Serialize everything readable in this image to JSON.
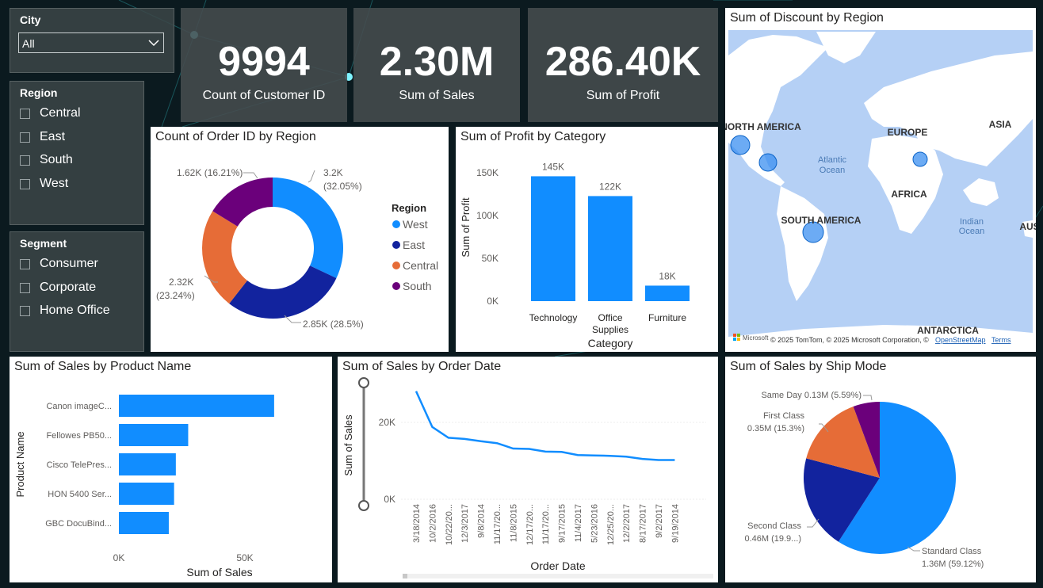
{
  "colors": {
    "blue": "#118DFF",
    "dark_blue": "#12239E",
    "orange": "#E66C37",
    "purple": "#6B007B",
    "map_land": "#ffffff",
    "map_water": "#b5d0f5"
  },
  "city_slicer": {
    "title": "City",
    "selected": "All"
  },
  "region_slicer": {
    "title": "Region",
    "items": [
      "Central",
      "East",
      "South",
      "West"
    ]
  },
  "segment_slicer": {
    "title": "Segment",
    "items": [
      "Consumer",
      "Corporate",
      "Home Office"
    ]
  },
  "kpis": [
    {
      "value": "9994",
      "label": "Count of Customer ID"
    },
    {
      "value": "2.30M",
      "label": "Sum of Sales"
    },
    {
      "value": "286.40K",
      "label": "Sum of Profit"
    }
  ],
  "donut": {
    "title": "Count of Order ID by Region",
    "legend_title": "Region",
    "legend": [
      "West",
      "East",
      "Central",
      "South"
    ],
    "labels": [
      "3.2K",
      "(32.05%)",
      "2.85K (28.5%)",
      "2.32K",
      "(23.24%)",
      "1.62K (16.21%)"
    ]
  },
  "profit_chart": {
    "title": "Sum of Profit by Category",
    "xlabel": "Category",
    "ylabel": "Sum of Profit",
    "ticks": [
      "0K",
      "50K",
      "100K",
      "150K"
    ],
    "category_lines": [
      [
        "Technology"
      ],
      [
        "Office",
        "Supplies"
      ],
      [
        "Furniture"
      ]
    ],
    "data_labels": [
      "145K",
      "122K",
      "18K"
    ]
  },
  "map": {
    "title": "Sum of Discount by Region",
    "continents": [
      "NORTH AMERICA",
      "EUROPE",
      "ASIA",
      "AFRICA",
      "SOUTH AMERICA",
      "ANTARCTICA",
      "AUS"
    ],
    "oceans": [
      "Atlantic",
      "Ocean",
      "Indian",
      "Ocean"
    ],
    "attribution": "© 2025 TomTom, © 2025 Microsoft Corporation, ©",
    "osm_link": "OpenStreetMap",
    "terms_link": "Terms",
    "brand": "Microsoft"
  },
  "product_chart": {
    "title": "Sum of Sales by Product Name",
    "xlabel": "Sum of Sales",
    "ylabel": "Product Name",
    "ticks": [
      "0K",
      "50K"
    ]
  },
  "date_chart": {
    "title": "Sum of Sales by Order Date",
    "xlabel": "Order Date",
    "ylabel": "Sum of Sales",
    "ticks": [
      "0K",
      "20K"
    ]
  },
  "pie": {
    "title": "Sum of Sales by Ship Mode",
    "labels": [
      "Same Day 0.13M (5.59%)",
      "First Class",
      "0.35M (15.3%)",
      "Second Class",
      "0.46M (19.9...)",
      "Standard Class",
      "1.36M (59.12%)"
    ]
  },
  "chart_data": [
    {
      "type": "pie",
      "title": "Count of Order ID by Region",
      "categories": [
        "West",
        "East",
        "Central",
        "South"
      ],
      "values": [
        3200,
        2850,
        2320,
        1620
      ],
      "percents": [
        32.05,
        28.5,
        23.24,
        16.21
      ]
    },
    {
      "type": "bar",
      "title": "Sum of Profit by Category",
      "categories": [
        "Technology",
        "Office Supplies",
        "Furniture"
      ],
      "values": [
        145,
        122,
        18
      ],
      "ylim": [
        0,
        150
      ]
    },
    {
      "type": "bar",
      "title": "Sum of Sales by Product Name",
      "categories": [
        "Canon imageC...",
        "Fellowes PB50...",
        "Cisco TelePres...",
        "HON 5400 Ser...",
        "GBC DocuBind..."
      ],
      "values": [
        61.6,
        27.5,
        22.6,
        21.9,
        19.8
      ],
      "xlim": [
        0,
        50
      ]
    },
    {
      "type": "line",
      "title": "Sum of Sales by Order Date",
      "x": [
        "3/18/2014",
        "10/2/2016",
        "10/22/20...",
        "12/3/2017",
        "9/8/2014",
        "11/17/20...",
        "11/8/2015",
        "12/17/20...",
        "11/17/20...",
        "9/17/2015",
        "11/4/2017",
        "5/23/2016",
        "12/25/20...",
        "12/2/2017",
        "8/17/2017",
        "9/2/2017",
        "9/19/2014"
      ],
      "values": [
        28.1,
        18.8,
        16.0,
        15.7,
        15.1,
        14.6,
        13.2,
        13.1,
        12.4,
        12.3,
        11.5,
        11.4,
        11.3,
        11.1,
        10.5,
        10.2,
        10.2
      ],
      "ylim": [
        0,
        20
      ]
    },
    {
      "type": "pie",
      "title": "Sum of Sales by Ship Mode",
      "categories": [
        "Standard Class",
        "Second Class",
        "First Class",
        "Same Day"
      ],
      "values": [
        1.36,
        0.46,
        0.35,
        0.13
      ],
      "percents": [
        59.12,
        19.9,
        15.3,
        5.59
      ]
    }
  ]
}
